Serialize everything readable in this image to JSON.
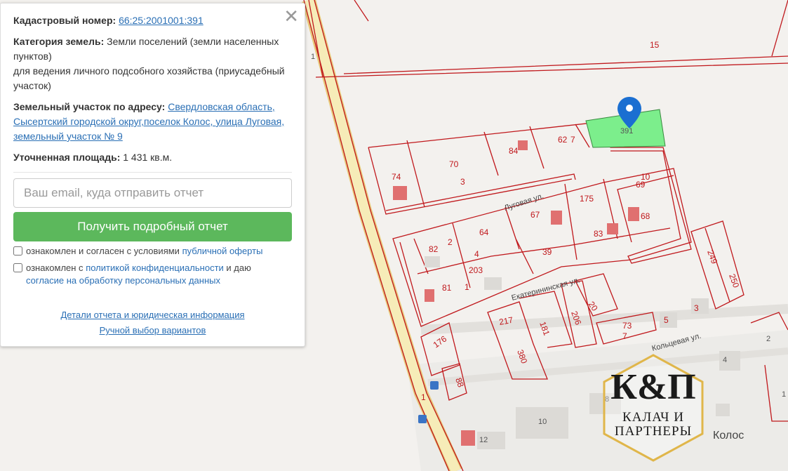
{
  "info_panel": {
    "cadastral_label": "Кадастровый номер:",
    "cadastral_value": "66:25:2001001:391",
    "category_label": "Категория земель:",
    "category_value": "Земли поселений (земли населенных пунктов)",
    "usage_value": "для ведения личного подсобного хозяйства (приусадебный участок)",
    "address_label": "Земельный участок по адресу:",
    "address_value": "Свердловская область, Сысертский городской округ,поселок Колос, улица Луговая, земельный участок № 9",
    "area_label": "Уточненная площадь:",
    "area_value": "1 431 кв.м.",
    "close_symbol": "✕",
    "email_placeholder": "Ваш email, куда отправить отчет",
    "submit_label": "Получить подробный отчет",
    "consent1_text": "ознакомлен и согласен с условиями",
    "consent1_link": "публичной оферты",
    "consent2_text_a": "ознакомлен с",
    "consent2_link_a": "политикой конфиденциальности",
    "consent2_text_b": "и даю",
    "consent2_link_b": "согласие на обработку персональных данных",
    "details_link": "Детали отчета и юридическая информация",
    "manual_link": "Ручной выбор вариантов"
  },
  "map": {
    "selected_plot": "391",
    "plot_labels": [
      "15",
      "74",
      "70",
      "3",
      "84",
      "62",
      "7",
      "391",
      "69",
      "10",
      "175",
      "67",
      "64",
      "82",
      "2",
      "4",
      "68",
      "83",
      "39",
      "203",
      "81",
      "1",
      "249",
      "250",
      "20",
      "3",
      "206",
      "181",
      "217",
      "73",
      "7",
      "5",
      "176",
      "380",
      "88",
      "1"
    ],
    "house_numbers": [
      "2",
      "4",
      "8",
      "10",
      "12",
      "1",
      "1"
    ],
    "streets": [
      "Луговая ул.",
      "Екатерининская ул.",
      "Кольцевая ул."
    ],
    "place_name": "Колос",
    "plot_color": "#c0181c",
    "selected_fill": "#7cee8c",
    "road_color": "#f3e6a0"
  },
  "logo": {
    "monogram": "К&П",
    "line1": "КАЛАЧ И",
    "line2": "ПАРТНЕРЫ"
  }
}
